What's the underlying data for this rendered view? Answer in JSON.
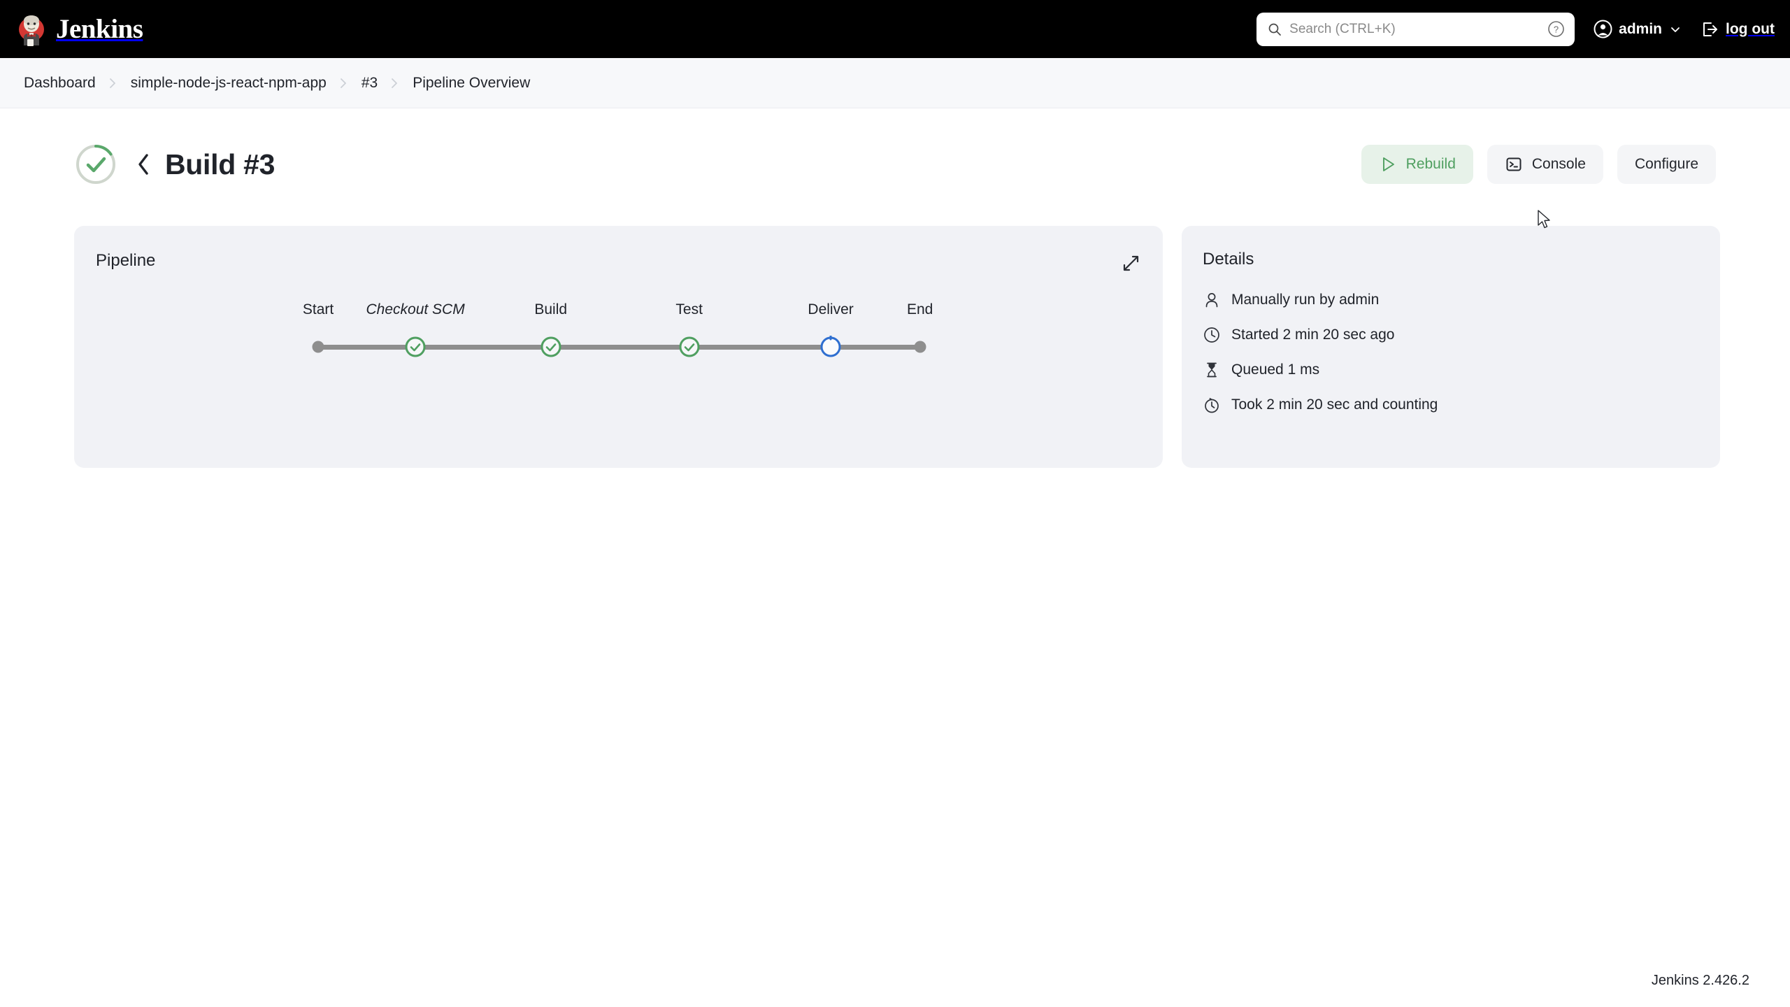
{
  "header": {
    "brand_title": "Jenkins",
    "brand_logo_icon": "jenkins-butler-logo",
    "search": {
      "icon": "search-icon",
      "placeholder": "Search (CTRL+K)",
      "value": "",
      "help_icon": "help-circle-icon"
    },
    "user": {
      "icon": "user-circle-icon",
      "name": "admin",
      "chevron_icon": "chevron-down-icon"
    },
    "logout": {
      "icon": "logout-icon",
      "label": "log out"
    },
    "background_color": "#000000"
  },
  "breadcrumb": {
    "separator_icon": "chevron-right-icon",
    "items": [
      {
        "label": "Dashboard"
      },
      {
        "label": "simple-node-js-react-npm-app"
      },
      {
        "label": "#3"
      },
      {
        "label": "Pipeline Overview"
      }
    ]
  },
  "build_header": {
    "status_icon": "build-success-circle-icon",
    "status": "success",
    "back_icon": "chevron-left-icon",
    "title": "Build #3",
    "actions": [
      {
        "label": "Rebuild",
        "icon": "play-triangle-icon",
        "style": "green"
      },
      {
        "label": "Console",
        "icon": "terminal-icon",
        "style": "default"
      },
      {
        "label": "Configure",
        "icon": "none",
        "style": "default"
      }
    ]
  },
  "pipeline_card": {
    "title": "Pipeline",
    "expand_icon": "expand-diagonal-icon",
    "stages": [
      {
        "label": "Start",
        "type": "terminal",
        "state": "neutral",
        "italic": false,
        "x_pct": 1.2
      },
      {
        "label": "Checkout SCM",
        "type": "stage",
        "state": "success",
        "italic": true,
        "x_pct": 17.0
      },
      {
        "label": "Build",
        "type": "stage",
        "state": "success",
        "italic": false,
        "x_pct": 39.0
      },
      {
        "label": "Test",
        "type": "stage",
        "state": "success",
        "italic": false,
        "x_pct": 61.5
      },
      {
        "label": "Deliver",
        "type": "stage",
        "state": "running",
        "italic": false,
        "x_pct": 84.5
      },
      {
        "label": "End",
        "type": "terminal",
        "state": "neutral",
        "italic": false,
        "x_pct": 99.0
      }
    ]
  },
  "details_card": {
    "title": "Details",
    "rows": [
      {
        "icon": "person-icon",
        "text": "Manually run by admin"
      },
      {
        "icon": "clock-icon",
        "text": "Started 2 min 20 sec ago"
      },
      {
        "icon": "hourglass-icon",
        "text": "Queued 1 ms"
      },
      {
        "icon": "stopwatch-icon",
        "text": "Took 2 min 20 sec and counting"
      }
    ]
  },
  "footer": {
    "version": "Jenkins 2.426.2"
  },
  "colors": {
    "header_bg": "#000000",
    "breadcrumb_bg": "#f7f8fa",
    "card_bg": "#f1f2f6",
    "page_bg": "#ffffff",
    "success_green": "#4f9f60",
    "running_blue": "#2f6fd0",
    "neutral_gray": "#8e8e8e",
    "rebuild_bg": "#e7f2e9",
    "button_bg": "#f4f5f7",
    "text": "#1f2229"
  }
}
